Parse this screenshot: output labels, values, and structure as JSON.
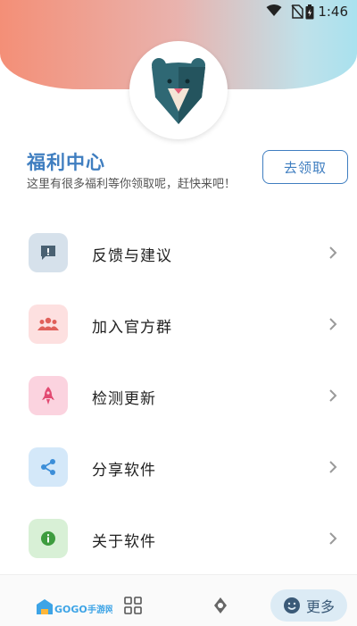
{
  "status": {
    "time": "1:46"
  },
  "welfare": {
    "title": "福利中心",
    "subtitle": "这里有很多福利等你领取呢，赶快来吧！",
    "claim_label": "去领取"
  },
  "menu": [
    {
      "label": "反馈与建议",
      "icon": "feedback-icon",
      "bg": "#d6e1eb",
      "fg": "#4a6172"
    },
    {
      "label": "加入官方群",
      "icon": "group-icon",
      "bg": "#fde0e0",
      "fg": "#e0605a"
    },
    {
      "label": "检测更新",
      "icon": "rocket-icon",
      "bg": "#fbd3df",
      "fg": "#e24a72"
    },
    {
      "label": "分享软件",
      "icon": "share-icon",
      "bg": "#d4e8f9",
      "fg": "#3c8ed8"
    },
    {
      "label": "关于软件",
      "icon": "info-icon",
      "bg": "#d8f0d6",
      "fg": "#3e9c3f"
    }
  ],
  "bottom_nav": {
    "logo_text": "GOGO手游网",
    "more_label": "更多"
  },
  "colors": {
    "accent": "#3f7ec0"
  }
}
